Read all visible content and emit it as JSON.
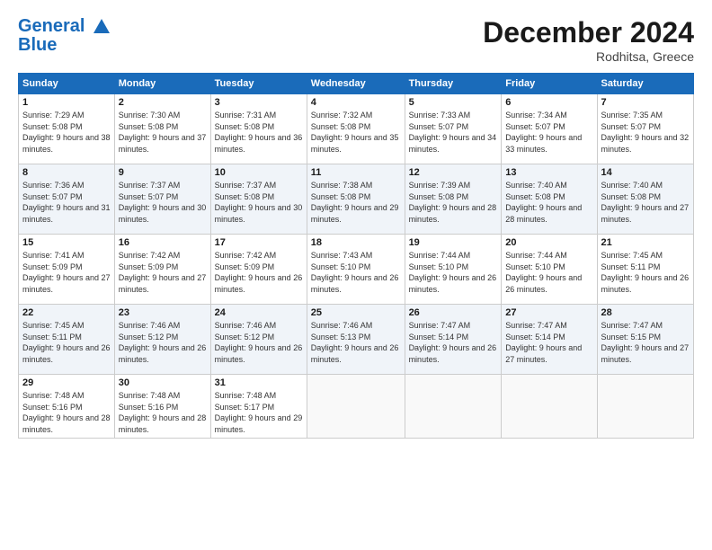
{
  "header": {
    "logo_line1": "General",
    "logo_line2": "Blue",
    "month": "December 2024",
    "location": "Rodhitsa, Greece"
  },
  "weekdays": [
    "Sunday",
    "Monday",
    "Tuesday",
    "Wednesday",
    "Thursday",
    "Friday",
    "Saturday"
  ],
  "weeks": [
    [
      {
        "day": "1",
        "sunrise": "Sunrise: 7:29 AM",
        "sunset": "Sunset: 5:08 PM",
        "daylight": "Daylight: 9 hours and 38 minutes."
      },
      {
        "day": "2",
        "sunrise": "Sunrise: 7:30 AM",
        "sunset": "Sunset: 5:08 PM",
        "daylight": "Daylight: 9 hours and 37 minutes."
      },
      {
        "day": "3",
        "sunrise": "Sunrise: 7:31 AM",
        "sunset": "Sunset: 5:08 PM",
        "daylight": "Daylight: 9 hours and 36 minutes."
      },
      {
        "day": "4",
        "sunrise": "Sunrise: 7:32 AM",
        "sunset": "Sunset: 5:08 PM",
        "daylight": "Daylight: 9 hours and 35 minutes."
      },
      {
        "day": "5",
        "sunrise": "Sunrise: 7:33 AM",
        "sunset": "Sunset: 5:07 PM",
        "daylight": "Daylight: 9 hours and 34 minutes."
      },
      {
        "day": "6",
        "sunrise": "Sunrise: 7:34 AM",
        "sunset": "Sunset: 5:07 PM",
        "daylight": "Daylight: 9 hours and 33 minutes."
      },
      {
        "day": "7",
        "sunrise": "Sunrise: 7:35 AM",
        "sunset": "Sunset: 5:07 PM",
        "daylight": "Daylight: 9 hours and 32 minutes."
      }
    ],
    [
      {
        "day": "8",
        "sunrise": "Sunrise: 7:36 AM",
        "sunset": "Sunset: 5:07 PM",
        "daylight": "Daylight: 9 hours and 31 minutes."
      },
      {
        "day": "9",
        "sunrise": "Sunrise: 7:37 AM",
        "sunset": "Sunset: 5:07 PM",
        "daylight": "Daylight: 9 hours and 30 minutes."
      },
      {
        "day": "10",
        "sunrise": "Sunrise: 7:37 AM",
        "sunset": "Sunset: 5:08 PM",
        "daylight": "Daylight: 9 hours and 30 minutes."
      },
      {
        "day": "11",
        "sunrise": "Sunrise: 7:38 AM",
        "sunset": "Sunset: 5:08 PM",
        "daylight": "Daylight: 9 hours and 29 minutes."
      },
      {
        "day": "12",
        "sunrise": "Sunrise: 7:39 AM",
        "sunset": "Sunset: 5:08 PM",
        "daylight": "Daylight: 9 hours and 28 minutes."
      },
      {
        "day": "13",
        "sunrise": "Sunrise: 7:40 AM",
        "sunset": "Sunset: 5:08 PM",
        "daylight": "Daylight: 9 hours and 28 minutes."
      },
      {
        "day": "14",
        "sunrise": "Sunrise: 7:40 AM",
        "sunset": "Sunset: 5:08 PM",
        "daylight": "Daylight: 9 hours and 27 minutes."
      }
    ],
    [
      {
        "day": "15",
        "sunrise": "Sunrise: 7:41 AM",
        "sunset": "Sunset: 5:09 PM",
        "daylight": "Daylight: 9 hours and 27 minutes."
      },
      {
        "day": "16",
        "sunrise": "Sunrise: 7:42 AM",
        "sunset": "Sunset: 5:09 PM",
        "daylight": "Daylight: 9 hours and 27 minutes."
      },
      {
        "day": "17",
        "sunrise": "Sunrise: 7:42 AM",
        "sunset": "Sunset: 5:09 PM",
        "daylight": "Daylight: 9 hours and 26 minutes."
      },
      {
        "day": "18",
        "sunrise": "Sunrise: 7:43 AM",
        "sunset": "Sunset: 5:10 PM",
        "daylight": "Daylight: 9 hours and 26 minutes."
      },
      {
        "day": "19",
        "sunrise": "Sunrise: 7:44 AM",
        "sunset": "Sunset: 5:10 PM",
        "daylight": "Daylight: 9 hours and 26 minutes."
      },
      {
        "day": "20",
        "sunrise": "Sunrise: 7:44 AM",
        "sunset": "Sunset: 5:10 PM",
        "daylight": "Daylight: 9 hours and 26 minutes."
      },
      {
        "day": "21",
        "sunrise": "Sunrise: 7:45 AM",
        "sunset": "Sunset: 5:11 PM",
        "daylight": "Daylight: 9 hours and 26 minutes."
      }
    ],
    [
      {
        "day": "22",
        "sunrise": "Sunrise: 7:45 AM",
        "sunset": "Sunset: 5:11 PM",
        "daylight": "Daylight: 9 hours and 26 minutes."
      },
      {
        "day": "23",
        "sunrise": "Sunrise: 7:46 AM",
        "sunset": "Sunset: 5:12 PM",
        "daylight": "Daylight: 9 hours and 26 minutes."
      },
      {
        "day": "24",
        "sunrise": "Sunrise: 7:46 AM",
        "sunset": "Sunset: 5:12 PM",
        "daylight": "Daylight: 9 hours and 26 minutes."
      },
      {
        "day": "25",
        "sunrise": "Sunrise: 7:46 AM",
        "sunset": "Sunset: 5:13 PM",
        "daylight": "Daylight: 9 hours and 26 minutes."
      },
      {
        "day": "26",
        "sunrise": "Sunrise: 7:47 AM",
        "sunset": "Sunset: 5:14 PM",
        "daylight": "Daylight: 9 hours and 26 minutes."
      },
      {
        "day": "27",
        "sunrise": "Sunrise: 7:47 AM",
        "sunset": "Sunset: 5:14 PM",
        "daylight": "Daylight: 9 hours and 27 minutes."
      },
      {
        "day": "28",
        "sunrise": "Sunrise: 7:47 AM",
        "sunset": "Sunset: 5:15 PM",
        "daylight": "Daylight: 9 hours and 27 minutes."
      }
    ],
    [
      {
        "day": "29",
        "sunrise": "Sunrise: 7:48 AM",
        "sunset": "Sunset: 5:16 PM",
        "daylight": "Daylight: 9 hours and 28 minutes."
      },
      {
        "day": "30",
        "sunrise": "Sunrise: 7:48 AM",
        "sunset": "Sunset: 5:16 PM",
        "daylight": "Daylight: 9 hours and 28 minutes."
      },
      {
        "day": "31",
        "sunrise": "Sunrise: 7:48 AM",
        "sunset": "Sunset: 5:17 PM",
        "daylight": "Daylight: 9 hours and 29 minutes."
      },
      null,
      null,
      null,
      null
    ]
  ]
}
